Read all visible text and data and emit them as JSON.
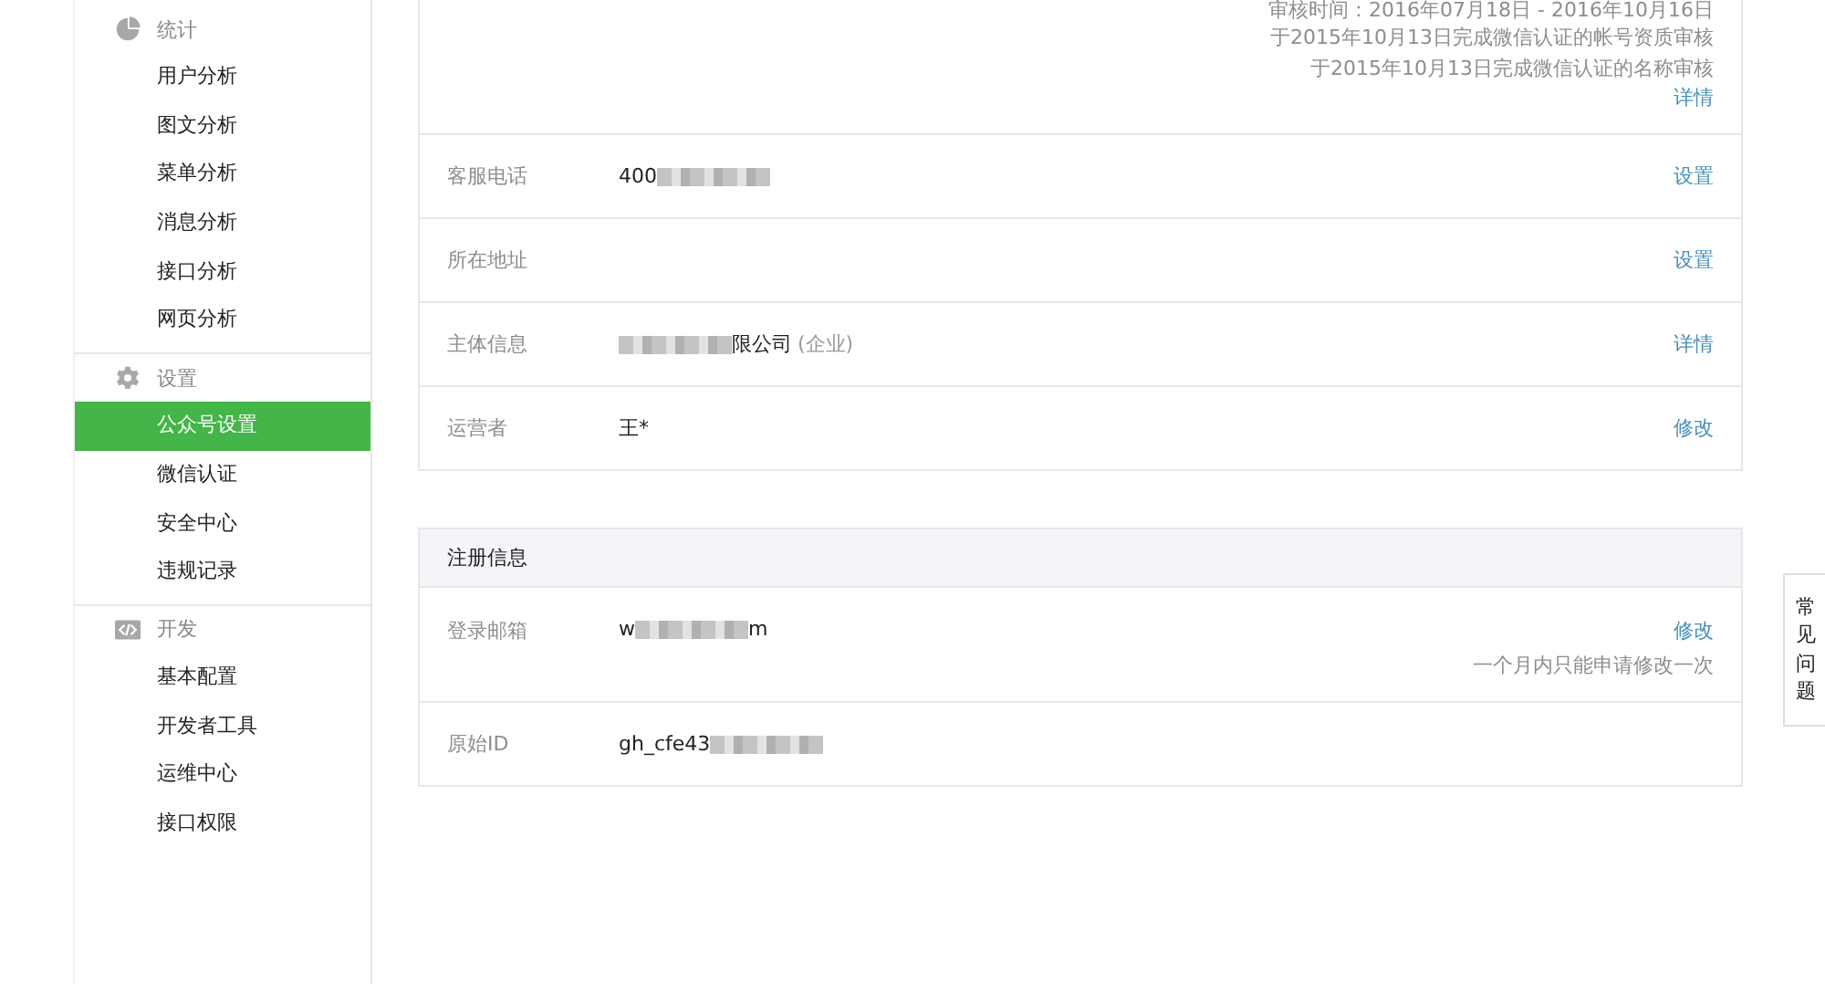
{
  "sidebar": {
    "sections": [
      {
        "title": "统计",
        "items": [
          {
            "label": "用户分析",
            "selected": false
          },
          {
            "label": "图文分析",
            "selected": false
          },
          {
            "label": "菜单分析",
            "selected": false
          },
          {
            "label": "消息分析",
            "selected": false
          },
          {
            "label": "接口分析",
            "selected": false
          },
          {
            "label": "网页分析",
            "selected": false
          }
        ]
      },
      {
        "title": "设置",
        "items": [
          {
            "label": "公众号设置",
            "selected": true
          },
          {
            "label": "微信认证",
            "selected": false
          },
          {
            "label": "安全中心",
            "selected": false
          },
          {
            "label": "违规记录",
            "selected": false
          }
        ]
      },
      {
        "title": "开发",
        "items": [
          {
            "label": "基本配置",
            "selected": false
          },
          {
            "label": "开发者工具",
            "selected": false
          },
          {
            "label": "运维中心",
            "selected": false
          },
          {
            "label": "接口权限",
            "selected": false
          }
        ]
      }
    ]
  },
  "account_panel": {
    "verification_lines": [
      "审核时间：2016年07月18日 - 2016年10月16日",
      "于2015年10月13日完成微信认证的帐号资质审核",
      "于2015年10月13日完成微信认证的名称审核"
    ],
    "verification_link": "详情",
    "rows": [
      {
        "label": "客服电话",
        "value_start": "400",
        "redacted": true,
        "link": "设置"
      },
      {
        "label": "所在地址",
        "redacted": false,
        "link": "设置"
      },
      {
        "label": "主体信息",
        "redacted": true,
        "value_end": "限公司",
        "tag": "(企业)",
        "link": "详情"
      },
      {
        "label": "运营者",
        "value_start": "王*",
        "redacted": false,
        "link": "修改"
      }
    ]
  },
  "registration_panel": {
    "title": "注册信息",
    "rows": [
      {
        "label": "登录邮箱",
        "value_start": "w",
        "redacted": true,
        "value_end": "m",
        "link": "修改",
        "note": "一个月内只能申请修改一次"
      },
      {
        "label": "原始ID",
        "value_start": "gh_cfe43",
        "redacted": true
      }
    ]
  },
  "faq_tab": {
    "label": "常见问题"
  }
}
